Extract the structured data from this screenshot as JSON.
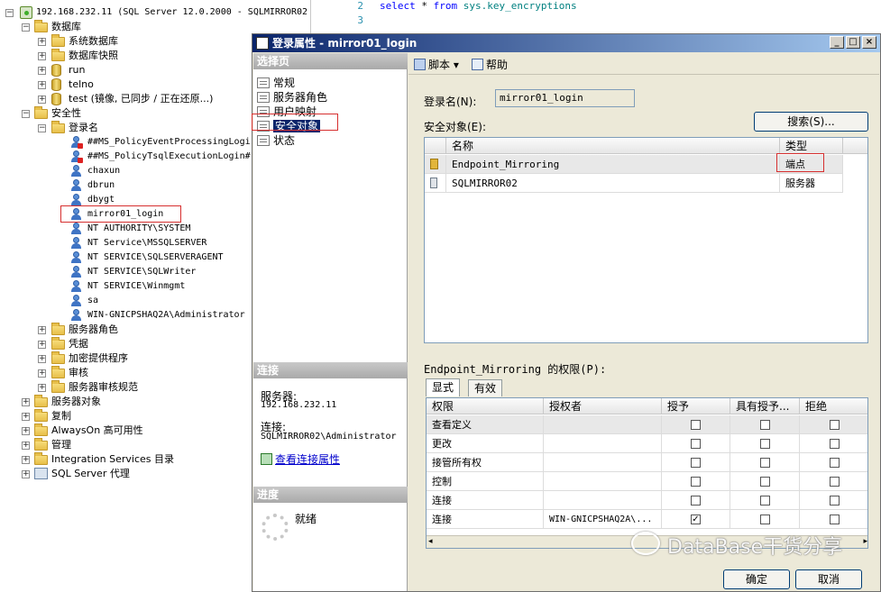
{
  "tree": {
    "server": "192.168.232.11 (SQL Server 12.0.2000 - SQLMIRROR02",
    "items": [
      {
        "label": "数据库",
        "pm": "−"
      },
      {
        "label": "系统数据库",
        "pm": "+"
      },
      {
        "label": "数据库快照",
        "pm": "+"
      },
      {
        "label": "run",
        "pm": "+"
      },
      {
        "label": "telno",
        "pm": "+"
      },
      {
        "label": "test (镜像, 已同步 / 正在还原...)",
        "pm": "+"
      },
      {
        "label": "安全性",
        "pm": "−"
      },
      {
        "label": "登录名",
        "pm": "−"
      },
      {
        "label": "##MS_PolicyEventProcessingLogi"
      },
      {
        "label": "##MS_PolicyTsqlExecutionLogin#"
      },
      {
        "label": "chaxun"
      },
      {
        "label": "dbrun"
      },
      {
        "label": "dbygt"
      },
      {
        "label": "mirror01_login"
      },
      {
        "label": "NT AUTHORITY\\SYSTEM"
      },
      {
        "label": "NT Service\\MSSQLSERVER"
      },
      {
        "label": "NT SERVICE\\SQLSERVERAGENT"
      },
      {
        "label": "NT SERVICE\\SQLWriter"
      },
      {
        "label": "NT SERVICE\\Winmgmt"
      },
      {
        "label": "sa"
      },
      {
        "label": "WIN-GNICPSHAQ2A\\Administrator"
      },
      {
        "label": "服务器角色",
        "pm": "+"
      },
      {
        "label": "凭据",
        "pm": "+"
      },
      {
        "label": "加密提供程序",
        "pm": "+"
      },
      {
        "label": "审核",
        "pm": "+"
      },
      {
        "label": "服务器审核规范",
        "pm": "+"
      },
      {
        "label": "服务器对象",
        "pm": "+"
      },
      {
        "label": "复制",
        "pm": "+"
      },
      {
        "label": "AlwaysOn 高可用性",
        "pm": "+"
      },
      {
        "label": "管理",
        "pm": "+"
      },
      {
        "label": "Integration Services 目录",
        "pm": "+"
      },
      {
        "label": "SQL Server 代理",
        "pm": "+"
      }
    ]
  },
  "editor": {
    "line2_num": "2",
    "line3_num": "3",
    "line2_kw1": "select",
    "line2_mid": " * ",
    "line2_kw2": "from",
    "line2_obj": " sys.key_encryptions"
  },
  "dialog": {
    "title": "登录属性 - mirror01_login",
    "pages_header": "选择页",
    "pages": [
      "常规",
      "服务器角色",
      "用户映射",
      "安全对象",
      "状态"
    ],
    "connection_header": "连接",
    "server_label": "服务器:",
    "server_value": "192.168.232.11",
    "connection_label": "连接:",
    "connection_value": "SQLMIRROR02\\Administrator",
    "view_conn_link": "查看连接属性",
    "progress_header": "进度",
    "progress_status": "就绪",
    "toolbar_script": "脚本",
    "toolbar_help": "帮助",
    "login_name_label": "登录名(N):",
    "login_name_value": "mirror01_login",
    "securables_label": "安全对象(E):",
    "search_button": "搜索(S)...",
    "securables_cols": [
      "名称",
      "类型"
    ],
    "securables": [
      {
        "name": "Endpoint_Mirroring",
        "type": "端点"
      },
      {
        "name": "SQLMIRROR02",
        "type": "服务器"
      }
    ],
    "perm_label": "Endpoint_Mirroring 的权限(P):",
    "tabs": [
      "显式",
      "有效"
    ],
    "perm_cols": [
      "权限",
      "授权者",
      "授予",
      "具有授予...",
      "拒绝"
    ],
    "perms": [
      {
        "perm": "查看定义",
        "grantor": "",
        "grant": false,
        "with_grant": false,
        "deny": false
      },
      {
        "perm": "更改",
        "grantor": "",
        "grant": false,
        "with_grant": false,
        "deny": false
      },
      {
        "perm": "接管所有权",
        "grantor": "",
        "grant": false,
        "with_grant": false,
        "deny": false
      },
      {
        "perm": "控制",
        "grantor": "",
        "grant": false,
        "with_grant": false,
        "deny": false
      },
      {
        "perm": "连接",
        "grantor": "",
        "grant": false,
        "with_grant": false,
        "deny": false
      },
      {
        "perm": "连接",
        "grantor": "WIN-GNICPSHAQ2A\\...",
        "grant": true,
        "with_grant": false,
        "deny": false
      }
    ],
    "ok_button": "确定",
    "cancel_button": "取消"
  },
  "watermark": "DataBase干货分享"
}
